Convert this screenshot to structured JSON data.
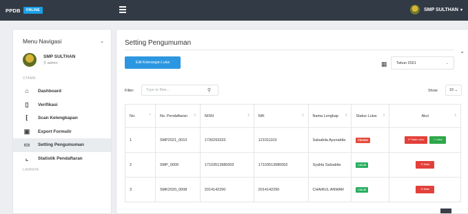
{
  "topbar": {
    "brand": "PPDB",
    "brand_badge": "ONLINE",
    "user_name": "SMP SULTHAN"
  },
  "sidebar": {
    "header": "Menu Navigasi",
    "profile_name": "SMP SULTHAN",
    "profile_role": "admin",
    "section_main": "UTAMA",
    "items": [
      {
        "label": "Dashboard",
        "icon": "home-icon"
      },
      {
        "label": "Verifikasi",
        "icon": "file-icon"
      },
      {
        "label": "Scan Kelengkapan",
        "icon": "scan-icon"
      },
      {
        "label": "Export Formulir",
        "icon": "export-icon"
      },
      {
        "label": "Setting Pengumuman",
        "icon": "monitor-icon"
      },
      {
        "label": "Statistik Pendaftaran",
        "icon": "chart-icon"
      }
    ],
    "section_other": "LAINNYA"
  },
  "main": {
    "title": "Setting Pengumuman",
    "edit_button": "Edit Keterangan Lulus",
    "year_select": "Tahun 2021",
    "filter_label": "Filter:",
    "filter_placeholder": "Type to filter...",
    "show_label": "Show",
    "show_value": "10"
  },
  "table": {
    "headers": [
      "No.",
      "No. Pendaftaran",
      "NISN",
      "NIK",
      "Nama Lengkap",
      "Status Lulus",
      "Aksi"
    ],
    "rows": [
      {
        "no": "1",
        "no_pendaftaran": "SMP2021_0010",
        "nisn": "1730293333",
        "nik": "121011103",
        "nama": "Salsabila Ayunabila",
        "status": "PROSES",
        "actions": [
          "Tidak Lulus",
          "Lulus"
        ]
      },
      {
        "no": "2",
        "no_pendaftaran": "SMP_0009",
        "nisn": "17103513980002",
        "nik": "17103513980002",
        "nama": "Syahla Salsabila",
        "status": "LULUS",
        "actions": [
          "Batal"
        ]
      },
      {
        "no": "3",
        "no_pendaftaran": "SMK2020_0008",
        "nisn": "2014142290",
        "nik": "2014142290",
        "nama": "CHAIRUL ANWAR",
        "status": "LULUS",
        "actions": [
          "Batal"
        ]
      }
    ]
  },
  "colors": {
    "topbar": "#323a45",
    "primary": "#2c97e0",
    "danger": "#e3403a",
    "success": "#2ea84a"
  }
}
